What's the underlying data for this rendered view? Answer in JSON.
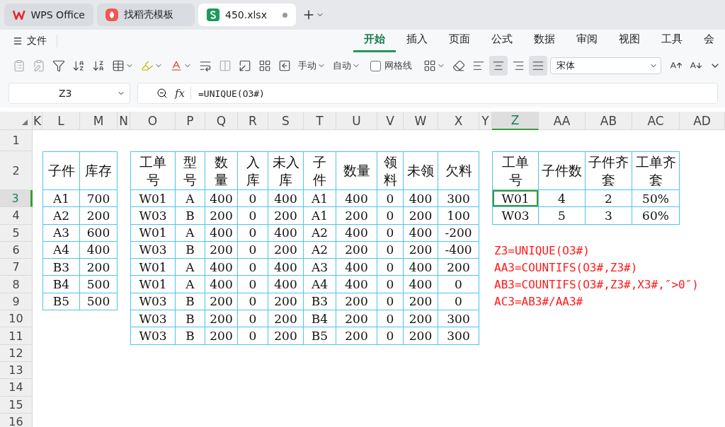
{
  "tabs": [
    {
      "title": "WPS Office",
      "kind": "wps",
      "selected": false
    },
    {
      "title": "找稻壳模板",
      "kind": "docer",
      "selected": false
    },
    {
      "title": "450.xlsx",
      "kind": "sheet",
      "selected": true
    }
  ],
  "menu": {
    "label": "文件"
  },
  "ribbon_tabs": [
    {
      "label": "开始",
      "selected": true
    },
    {
      "label": "插入",
      "selected": false
    },
    {
      "label": "页面",
      "selected": false
    },
    {
      "label": "公式",
      "selected": false
    },
    {
      "label": "数据",
      "selected": false
    },
    {
      "label": "审阅",
      "selected": false
    },
    {
      "label": "视图",
      "selected": false
    },
    {
      "label": "工具",
      "selected": false
    },
    {
      "label": "会",
      "selected": false
    }
  ],
  "toolbar": {
    "wrap_modes": [
      {
        "label": "手动"
      },
      {
        "label": "自动"
      }
    ],
    "gridlines": {
      "label": "网格线",
      "checked": false
    },
    "alignment": [
      {
        "selected": false
      },
      {
        "selected": true
      },
      {
        "selected": false
      },
      {
        "selected": true
      }
    ],
    "font": "宋体"
  },
  "formula_bar": {
    "cell": "Z3",
    "fx": "fx",
    "formula": "=UNIQUE(O3#)"
  },
  "columns": [
    {
      "label": "K",
      "selected": false
    },
    {
      "label": "L",
      "selected": false
    },
    {
      "label": "M",
      "selected": false
    },
    {
      "label": "N",
      "selected": false
    },
    {
      "label": "O",
      "selected": false
    },
    {
      "label": "P",
      "selected": false
    },
    {
      "label": "Q",
      "selected": false
    },
    {
      "label": "R",
      "selected": false
    },
    {
      "label": "S",
      "selected": false
    },
    {
      "label": "T",
      "selected": false
    },
    {
      "label": "U",
      "selected": false
    },
    {
      "label": "V",
      "selected": false
    },
    {
      "label": "W",
      "selected": false
    },
    {
      "label": "X",
      "selected": false
    },
    {
      "label": "Y",
      "selected": false
    },
    {
      "label": "Z",
      "selected": true
    },
    {
      "label": "AA",
      "selected": false
    },
    {
      "label": "AB",
      "selected": false
    },
    {
      "label": "AC",
      "selected": false
    },
    {
      "label": "AD",
      "selected": false
    }
  ],
  "rows": [
    {
      "label": "1",
      "selected": false
    },
    {
      "label": "2",
      "selected": false
    },
    {
      "label": "3",
      "selected": true
    },
    {
      "label": "4",
      "selected": false
    },
    {
      "label": "5",
      "selected": false
    },
    {
      "label": "6",
      "selected": false
    },
    {
      "label": "7",
      "selected": false
    },
    {
      "label": "8",
      "selected": false
    },
    {
      "label": "9",
      "selected": false
    },
    {
      "label": "10",
      "selected": false
    },
    {
      "label": "11",
      "selected": false
    },
    {
      "label": "12",
      "selected": false
    },
    {
      "label": "13",
      "selected": false
    },
    {
      "label": "14",
      "selected": false
    },
    {
      "label": "15",
      "selected": false
    },
    {
      "label": "16",
      "selected": false
    }
  ],
  "tables": [
    {
      "header": [
        "子件",
        "库存"
      ],
      "rows": [
        [
          "A1",
          "700"
        ],
        [
          "A2",
          "200"
        ],
        [
          "A3",
          "600"
        ],
        [
          "A4",
          "400"
        ],
        [
          "B3",
          "200"
        ],
        [
          "B4",
          "500"
        ],
        [
          "B5",
          "500"
        ]
      ]
    },
    {
      "header": [
        "工单号",
        "型号",
        "数量",
        "入库",
        "未入库",
        "子件",
        "数量",
        "领料",
        "未领",
        "欠料"
      ],
      "rows": [
        [
          "W01",
          "A",
          "400",
          "0",
          "400",
          "A1",
          "400",
          "0",
          "400",
          "300"
        ],
        [
          "W03",
          "B",
          "200",
          "0",
          "200",
          "A1",
          "200",
          "0",
          "200",
          "100"
        ],
        [
          "W01",
          "A",
          "400",
          "0",
          "400",
          "A2",
          "400",
          "0",
          "400",
          "-200"
        ],
        [
          "W03",
          "B",
          "200",
          "0",
          "200",
          "A2",
          "200",
          "0",
          "200",
          "-400"
        ],
        [
          "W01",
          "A",
          "400",
          "0",
          "400",
          "A3",
          "400",
          "0",
          "400",
          "200"
        ],
        [
          "W01",
          "A",
          "400",
          "0",
          "400",
          "A4",
          "400",
          "0",
          "400",
          "0"
        ],
        [
          "W03",
          "B",
          "200",
          "0",
          "200",
          "B3",
          "200",
          "0",
          "200",
          "0"
        ],
        [
          "W03",
          "B",
          "200",
          "0",
          "200",
          "B4",
          "200",
          "0",
          "200",
          "300"
        ],
        [
          "W03",
          "B",
          "200",
          "0",
          "200",
          "B5",
          "200",
          "0",
          "200",
          "300"
        ]
      ]
    },
    {
      "header": [
        "工单号",
        "子件数",
        "子件齐套",
        "工单齐套"
      ],
      "rows": [
        [
          {
            "text": "W01",
            "selected": true
          },
          {
            "text": "4",
            "selected": false
          },
          {
            "text": "2",
            "selected": false
          },
          {
            "text": "50%",
            "selected": false
          }
        ],
        [
          {
            "text": "W03",
            "selected": false
          },
          {
            "text": "5",
            "selected": false
          },
          {
            "text": "3",
            "selected": false
          },
          {
            "text": "60%",
            "selected": false
          }
        ]
      ]
    }
  ],
  "notes": [
    "Z3=UNIQUE(O3#)",
    "AA3=COUNTIFS(O3#,Z3#)",
    "AB3=COUNTIFS(O3#,Z3#,X3#,″>0″)",
    "AC3=AB3#/AA3#"
  ]
}
